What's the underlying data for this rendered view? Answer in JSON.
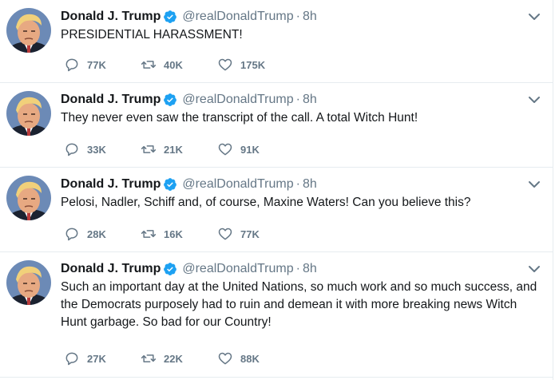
{
  "colors": {
    "verified": "#1da1f2",
    "muted": "#657786",
    "text": "#14171a",
    "divider": "#e6ecf0"
  },
  "tweets": [
    {
      "name": "Donald J. Trump",
      "handle": "@realDonaldTrump",
      "separator": "·",
      "time": "8h",
      "text": "PRESIDENTIAL HARASSMENT!",
      "replies": "77K",
      "retweets": "40K",
      "likes": "175K",
      "icons": [
        "avatar",
        "verified-badge-icon",
        "chevron-down-icon",
        "reply-icon",
        "retweet-icon",
        "like-icon"
      ]
    },
    {
      "name": "Donald J. Trump",
      "handle": "@realDonaldTrump",
      "separator": "·",
      "time": "8h",
      "text": "They never even saw the transcript of the call. A total Witch Hunt!",
      "replies": "33K",
      "retweets": "21K",
      "likes": "91K"
    },
    {
      "name": "Donald J. Trump",
      "handle": "@realDonaldTrump",
      "separator": "·",
      "time": "8h",
      "text": "Pelosi, Nadler, Schiff and, of course, Maxine Waters! Can you believe this?",
      "replies": "28K",
      "retweets": "16K",
      "likes": "77K"
    },
    {
      "name": "Donald J. Trump",
      "handle": "@realDonaldTrump",
      "separator": "·",
      "time": "8h",
      "text": "Such an important day at the United Nations, so much work and so much success, and the Democrats purposely had to ruin and demean it with more breaking news Witch Hunt garbage. So bad for our Country!",
      "replies": "27K",
      "retweets": "22K",
      "likes": "88K"
    }
  ]
}
